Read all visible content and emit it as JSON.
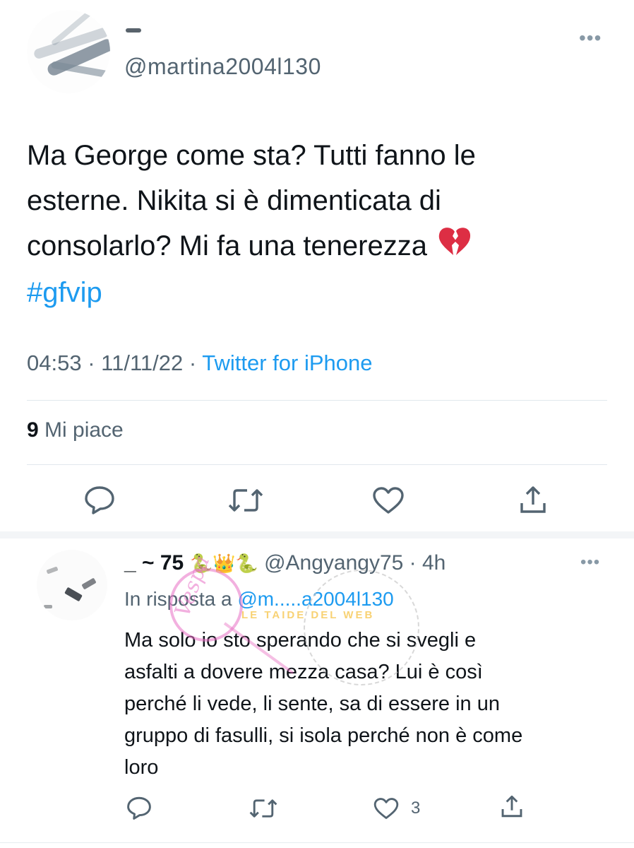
{
  "main_tweet": {
    "handle": "@martina2004l130",
    "text_lines": [
      "Ma George come sta? Tutti fanno le",
      "esterne. Nikita si è dimenticata di",
      "consolarlo?  Mi fa una tenerezza"
    ],
    "heart_emoji": "💔",
    "hashtag": "#gfvip",
    "time": "04:53",
    "date": "11/11/22",
    "separator": "·",
    "source": "Twitter for iPhone",
    "likes_count": "9",
    "likes_label": "Mi piace",
    "more_label": "•••"
  },
  "reply": {
    "name": "_ ~ 75",
    "name_emojis": "🐍👑🐍",
    "handle": "@Angyangy75",
    "time_ago": "· 4h",
    "reply_to_prefix": "In risposta a",
    "reply_to_handle": "@m.....a2004l130",
    "text_lines": [
      "Ma solo io sto sperando che si svegli e",
      "asfalti a dovere mezza casa? Lui è così",
      "perché li vede, li sente, sa di essere in un",
      "gruppo di fasulli, si isola perché non è come",
      "loro"
    ],
    "like_count": "3",
    "more_label": "•••",
    "watermark_script": "Vespa",
    "watermark_banner": "LE TAIDE DEL WEB"
  },
  "icons": {
    "reply": "reply-bubble-icon",
    "retweet": "retweet-icon",
    "like": "heart-icon",
    "share": "share-icon"
  },
  "colors": {
    "text": "#0f1419",
    "secondary": "#536471",
    "accent": "#1d9bf0",
    "divider": "#e1e8ed"
  }
}
